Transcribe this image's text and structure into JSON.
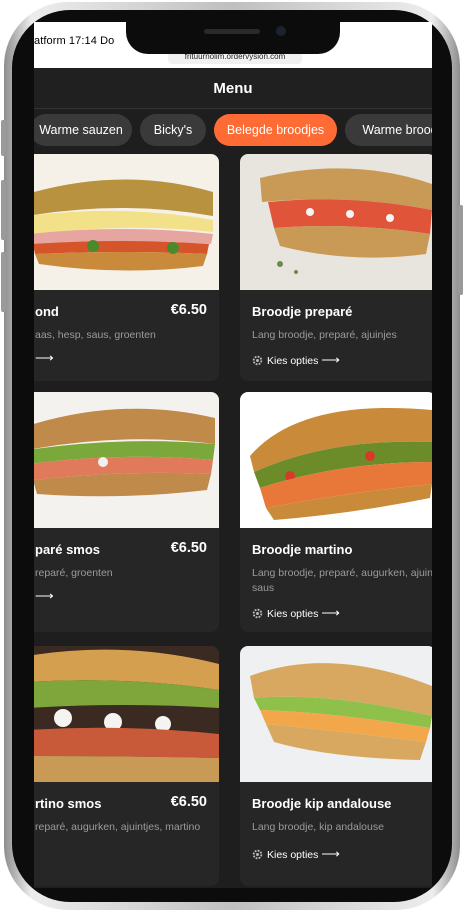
{
  "status": {
    "text": "atform  17:14  Do",
    "url": "frituurnolim.ordervysion.com"
  },
  "header": {
    "title": "Menu"
  },
  "categories": [
    {
      "label": "Warme sauzen"
    },
    {
      "label": "Bicky's"
    },
    {
      "label": "Belegde broodjes"
    },
    {
      "label": "Warme brood"
    }
  ],
  "active_category_color": "#ff6b35",
  "products": [
    {
      "name": "ond",
      "price": "€6.50",
      "desc": "aas, hesp, saus, groenten",
      "options_label": "",
      "options_icon": "gear-icon"
    },
    {
      "name": "Broodje preparé",
      "price": "",
      "desc": "Lang broodje, preparé, ajuinjes",
      "options_label": "Kies opties",
      "options_icon": "gear-icon"
    },
    {
      "name": "paré smos",
      "price": "€6.50",
      "desc": "reparé, groenten",
      "options_label": "",
      "options_icon": "gear-icon"
    },
    {
      "name": "Broodje martino",
      "price": "",
      "desc": "Lang broodje, preparé, augurken, ajuin saus",
      "options_label": "Kies opties",
      "options_icon": "gear-icon"
    },
    {
      "name": "rtino smos",
      "price": "€6.50",
      "desc": "reparé, augurken, ajuintjes, martino",
      "options_label": "",
      "options_icon": "gear-icon"
    },
    {
      "name": "Broodje kip andalouse",
      "price": "",
      "desc": "Lang broodje, kip andalouse",
      "options_label": "Kies opties",
      "options_icon": "gear-icon"
    }
  ]
}
